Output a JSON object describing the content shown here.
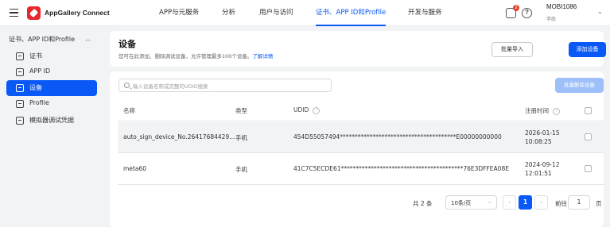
{
  "topbar": {
    "brand": "AppGallery Connect",
    "nav": [
      {
        "label": "APP与元服务",
        "active": false
      },
      {
        "label": "分析",
        "active": false
      },
      {
        "label": "用户与访问",
        "active": false
      },
      {
        "label": "证书、APP ID和Profile",
        "active": true
      },
      {
        "label": "开发与服务",
        "active": false
      }
    ],
    "notification_count": "2",
    "help_glyph": "?",
    "user_name": "MOBI1086",
    "user_role": "李政"
  },
  "sidebar": {
    "group_label": "证书、APP ID和Profile",
    "items": [
      {
        "label": "证书",
        "active": false
      },
      {
        "label": "APP ID",
        "active": false
      },
      {
        "label": "设备",
        "active": true
      },
      {
        "label": "Profile",
        "active": false
      },
      {
        "label": "模拟器调试凭据",
        "active": false
      }
    ]
  },
  "main": {
    "title": "设备",
    "description": "您可在此添加、删除调试设备，允许管理最多100个设备。",
    "learn_more": "了解详情",
    "import_label": "批量导入",
    "add_label": "添加设备",
    "search_placeholder": "输入设备名称或完整的UDID搜索",
    "batch_delete_label": "批量删除设备",
    "columns": {
      "name": "名称",
      "type": "类型",
      "udid": "UDID",
      "time": "注册时间"
    },
    "rows": [
      {
        "name": "auto_sign_device_No.26417684429...",
        "type": "手机",
        "udid": "454D55057494***************************************E00000000000",
        "date": "2026-01-15",
        "time": "10:08:25"
      },
      {
        "name": "meta60",
        "type": "手机",
        "udid": "41C7C5ECDE61*****************************************76E3DFFEA08E",
        "date": "2024-09-12",
        "time": "12:01:51"
      }
    ],
    "pager": {
      "total": "共 2 条",
      "page_size": "10条/页",
      "current_page": "1",
      "goto_label": "前往",
      "goto_value": "1",
      "page_suffix": "页"
    }
  },
  "colors": {
    "accent": "#0a59f7",
    "brand_red": "#e6282e",
    "badge": "#e84026"
  }
}
